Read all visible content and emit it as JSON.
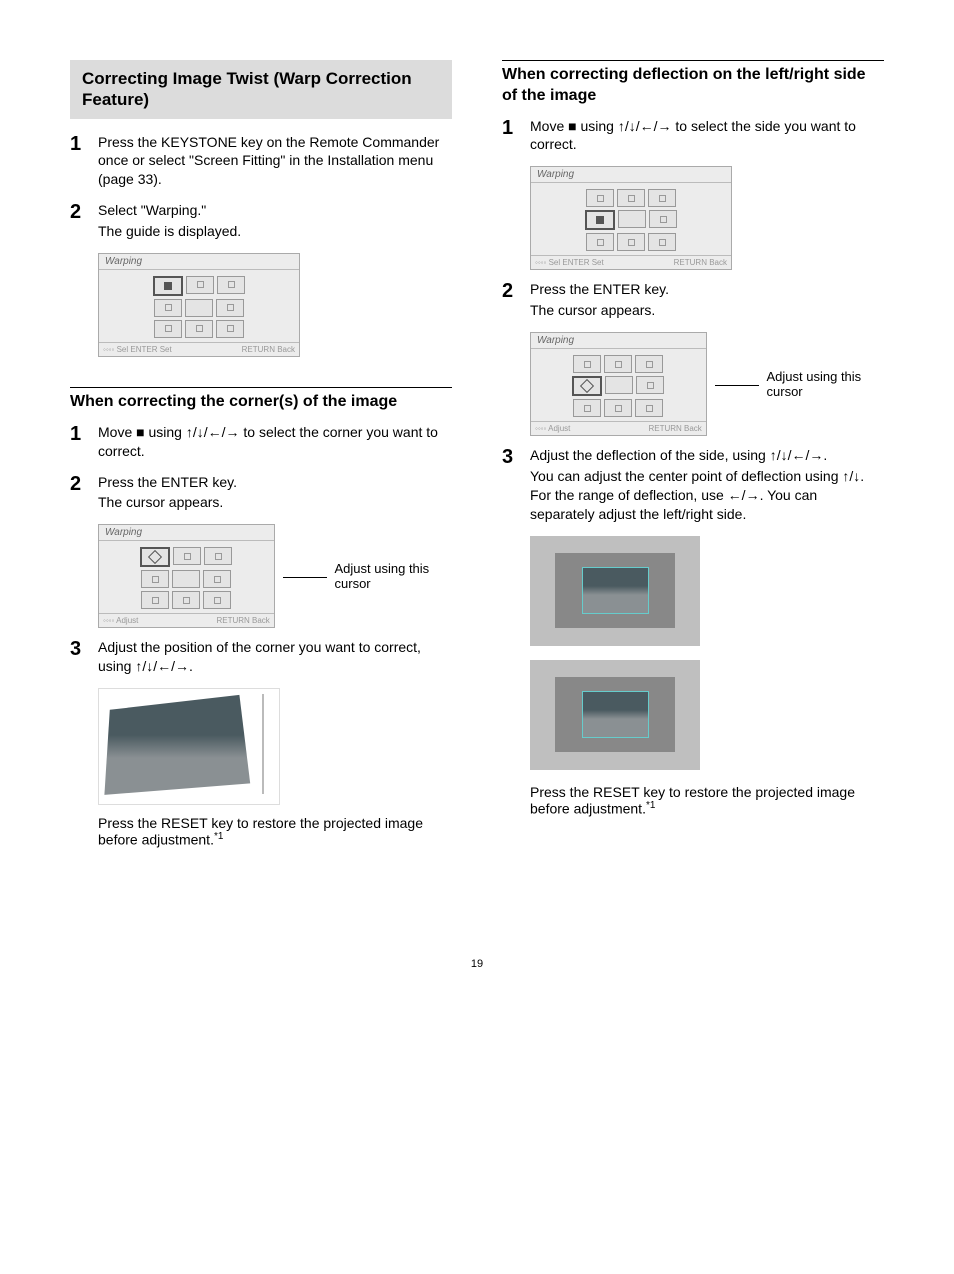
{
  "page_number": "19",
  "left": {
    "heading": "Correcting Image Twist (Warp Correction Feature)",
    "steps_a": [
      {
        "num": "1",
        "text": "Press the KEYSTONE key on the Remote Commander once or select \"Screen Fitting\" in the Installation menu (page 33)."
      },
      {
        "num": "2",
        "text": "Select \"Warping.\"",
        "text2": "The guide is displayed."
      }
    ],
    "warp_menu_title": "Warping",
    "warp_menu_foot_left": "◦◦◦◦ Sel   ENTER Set",
    "warp_menu_foot_right": "RETURN Back",
    "sub_heading": "When correcting the corner(s) of the image",
    "steps_b": [
      {
        "num": "1",
        "text": "Move ■ using ↑/↓/←/→ to select the corner you want to correct."
      },
      {
        "num": "2",
        "text": "Press the ENTER key.",
        "text2": "The cursor appears."
      }
    ],
    "cursor_label": "Adjust using this cursor",
    "warp_menu_adjust_foot_left": "◦◦◦◦ Adjust",
    "steps_c": [
      {
        "num": "3",
        "text": "Adjust the position of the corner you want to correct, using ↑/↓/←/→."
      }
    ],
    "reset_note": "Press the RESET key to restore the projected image before adjustment.",
    "reset_note_ref": "*1"
  },
  "right": {
    "sub_heading": "When correcting deflection on the left/right side of the image",
    "steps_a": [
      {
        "num": "1",
        "text": "Move ■ using ↑/↓/←/→ to select the side you want to correct."
      }
    ],
    "warp_menu_title": "Warping",
    "warp_menu_foot_left": "◦◦◦◦ Sel   ENTER Set",
    "warp_menu_foot_right": "RETURN Back",
    "steps_b": [
      {
        "num": "2",
        "text": "Press the ENTER key.",
        "text2": "The cursor appears."
      }
    ],
    "cursor_label": "Adjust using this cursor",
    "warp_menu_adjust_foot_left": "◦◦◦◦ Adjust",
    "steps_c": [
      {
        "num": "3",
        "text": "Adjust the deflection of the side, using ↑/↓/←/→.",
        "text2": "You can adjust the center point of deflection using ↑/↓. For the range of deflection, use ←/→. You can separately adjust the left/right side."
      }
    ],
    "reset_note": "Press the RESET key to restore the projected image before adjustment.",
    "reset_note_ref": "*1"
  }
}
